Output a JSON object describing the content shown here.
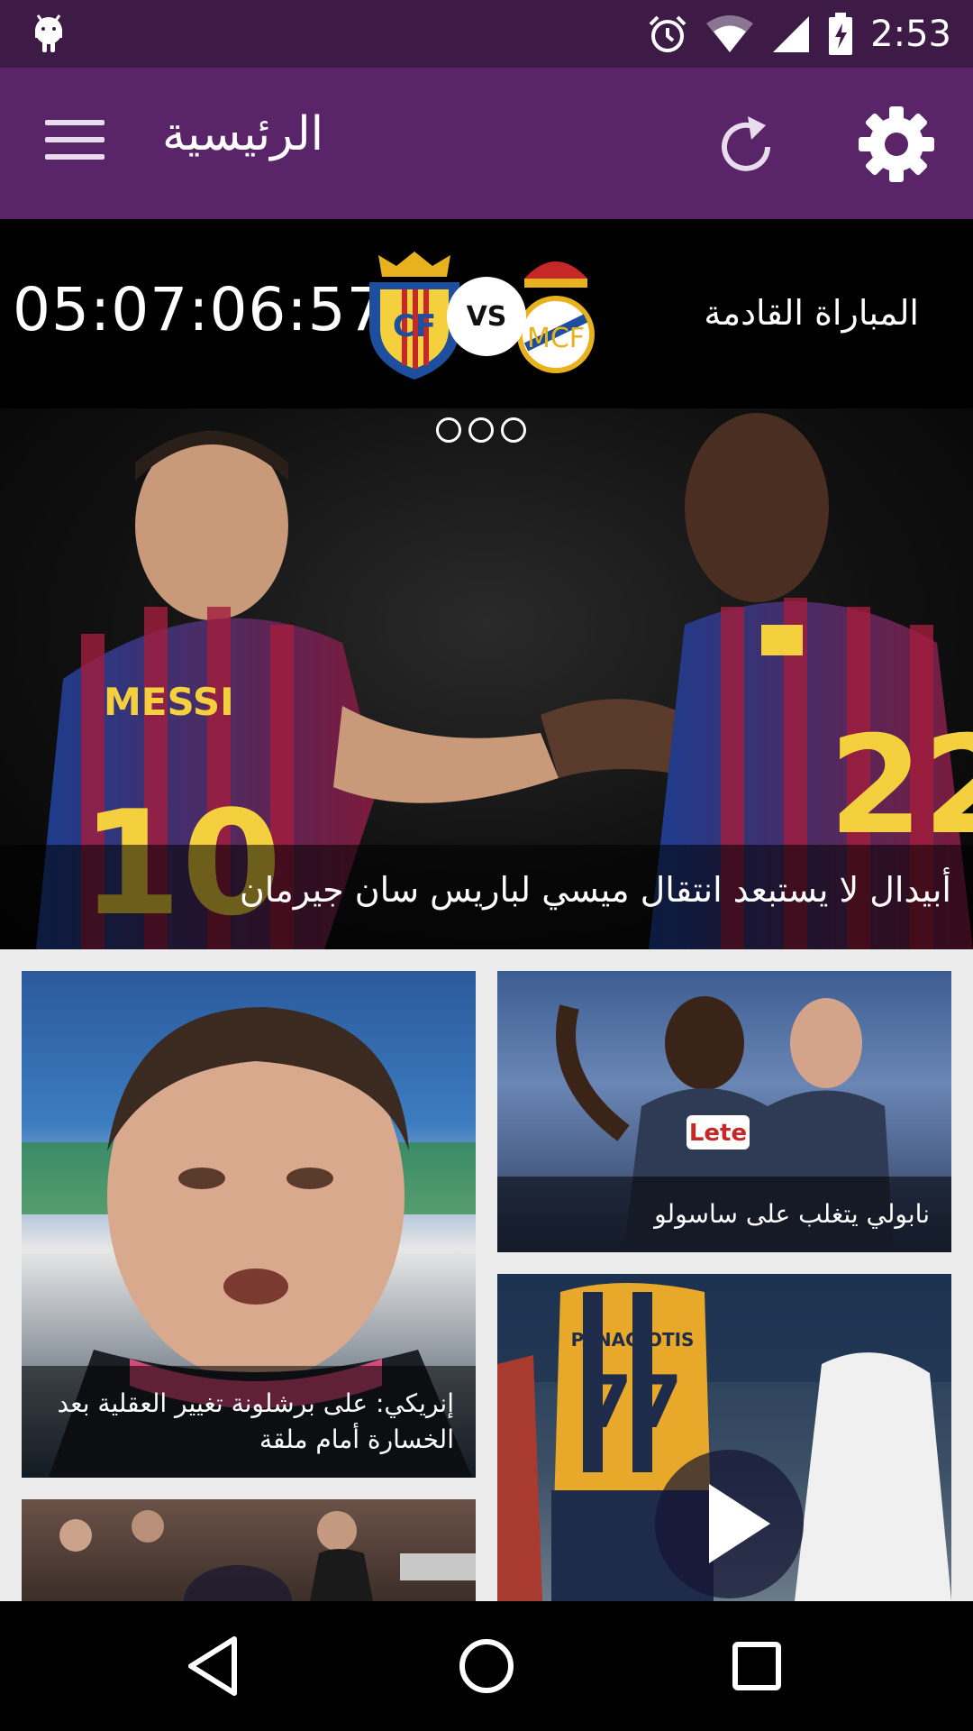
{
  "status_bar": {
    "time": "2:53"
  },
  "toolbar": {
    "title": "الرئيسية"
  },
  "next_match": {
    "label": "المباراة القادمة",
    "countdown": "05:07:06:57",
    "vs": "VS"
  },
  "hero": {
    "caption": "أبيدال لا يستبعد انتقال ميسي لباريس سان جيرمان",
    "jersey_text_left": "MESSI",
    "jersey_number_left": "10",
    "jersey_number_right": "22"
  },
  "cards": [
    {
      "caption": "نابولي يتغلب على ساسولو",
      "shirt_text": "Lete"
    },
    {
      "caption": "إنريكي: على برشلونة تغيير العقلية بعد الخسارة أمام ملقة"
    },
    {
      "caption": "",
      "shirt_text": "PANAGIOTIS",
      "shirt_number": "77"
    }
  ],
  "colors": {
    "status_bar": "#3e1a47",
    "toolbar": "#5a2568",
    "grid_bg": "#ececec"
  }
}
